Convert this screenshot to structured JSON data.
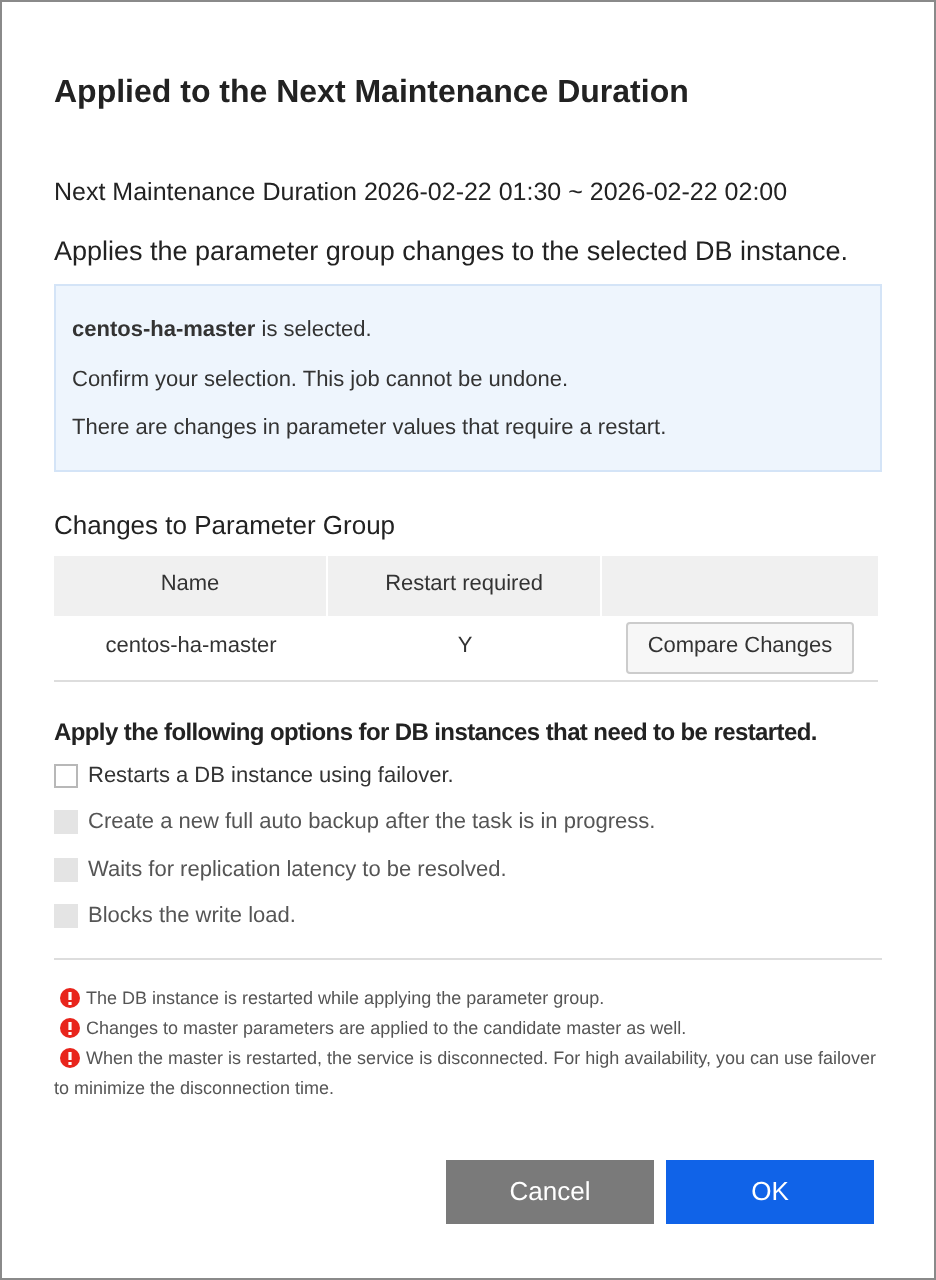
{
  "title": "Applied to the Next Maintenance Duration",
  "maintenance": "Next Maintenance Duration 2026-02-22 01:30 ~ 2026-02-22 02:00",
  "subtitle": "Applies the parameter group changes to the selected DB instance.",
  "info_lines": [
    "**centos-ha-master** is selected.",
    "Confirm your selection. This job cannot be undone.",
    "There are changes in parameter values that require a restart."
  ],
  "table": {
    "title": "Changes to Parameter Group",
    "columns": [
      "Name",
      "Restart required"
    ],
    "rows": [
      {
        "name": "centos-ha-master",
        "restart_required": "Y",
        "action": "Compare Changes"
      }
    ]
  },
  "options": {
    "title": "Apply the following options for DB instances that need to be restarted.",
    "items": [
      {
        "label": "Restarts a DB instance using failover.",
        "checked": false,
        "disabled": false
      },
      {
        "label": "Create a new full auto backup after the task is in progress.",
        "checked": false,
        "disabled": true
      },
      {
        "label": "Waits for replication latency to be resolved.",
        "checked": false,
        "disabled": true
      },
      {
        "label": "Blocks the write load.",
        "checked": false,
        "disabled": true
      }
    ]
  },
  "notes": [
    "The DB instance is restarted while applying the parameter group.",
    "Changes to master parameters are applied to the candidate master as well.",
    "When the master is restarted, the service is disconnected. For high availability, you can use failover to minimize the disconnection time."
  ],
  "buttons": {
    "cancel": "Cancel",
    "ok": "OK"
  }
}
